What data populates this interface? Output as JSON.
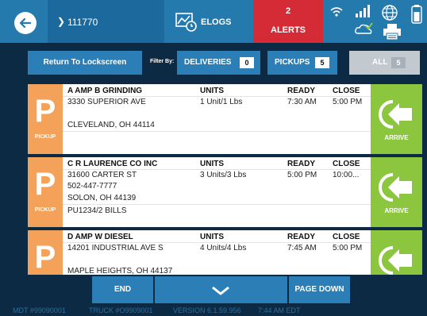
{
  "header": {
    "trip_number": "111770",
    "elogs_label": "ELOGS",
    "alerts_count": "2",
    "alerts_label": "ALERTS",
    "icons": [
      "back-arrow-icon",
      "chevron-right-icon",
      "elogs-chart-icon",
      "wifi-icon",
      "signal-bars-icon",
      "globe-check-icon",
      "printer-icon",
      "phone-battery-icon"
    ]
  },
  "filters": {
    "lockscreen_label": "Return To Lockscreen",
    "filter_by_label": "Filter By:",
    "deliveries_label": "DELIVERIES",
    "deliveries_count": "0",
    "pickups_label": "PICKUPS",
    "pickups_count": "5",
    "all_label": "ALL",
    "all_count": "5"
  },
  "columns": {
    "units": "UNITS",
    "ready": "READY",
    "close": "CLOSE"
  },
  "stops": [
    {
      "type_letter": "P",
      "type_label": "PICKUP",
      "name": "A AMP B GRINDING",
      "address1": "3330 SUPERIOR AVE",
      "phone": "",
      "city": "CLEVELAND, OH 44114",
      "note": "",
      "units": "1 Unit/1 Lbs",
      "ready": "7:30 AM",
      "close": "5:00 PM",
      "action_label": "ARRIVE"
    },
    {
      "type_letter": "P",
      "type_label": "PICKUP",
      "name": "C R LAURENCE CO INC",
      "address1": "31600 CARTER ST",
      "phone": "502-447-7777",
      "city": "SOLON, OH 44139",
      "note": "PU1234/2 BILLS",
      "units": "3 Units/3 Lbs",
      "ready": "5:00 PM",
      "close": "10:00...",
      "action_label": "ARRIVE"
    },
    {
      "type_letter": "P",
      "type_label": "",
      "name": "D AMP W DIESEL",
      "address1": "14201 INDUSTRIAL AVE S",
      "phone": "",
      "city": "MAPLE HEIGHTS, OH 44137",
      "note": "",
      "units": "4 Units/4 Lbs",
      "ready": "7:45 AM",
      "close": "5:00 PM",
      "action_label": ""
    }
  ],
  "nav": {
    "end_label": "END",
    "page_down_label": "PAGE DOWN"
  },
  "footer": {
    "mdt": "MDT #99090001",
    "truck": "TRUCK #O9909001",
    "version": "VERSION 6.1.59.956",
    "time": "7:44 AM EDT"
  },
  "colors": {
    "header_blue": "#2479ad",
    "alerts_red": "#d42b36",
    "pickup_orange": "#f4a25a",
    "arrive_green": "#8cc63f",
    "background_navy": "#0d2a44"
  }
}
